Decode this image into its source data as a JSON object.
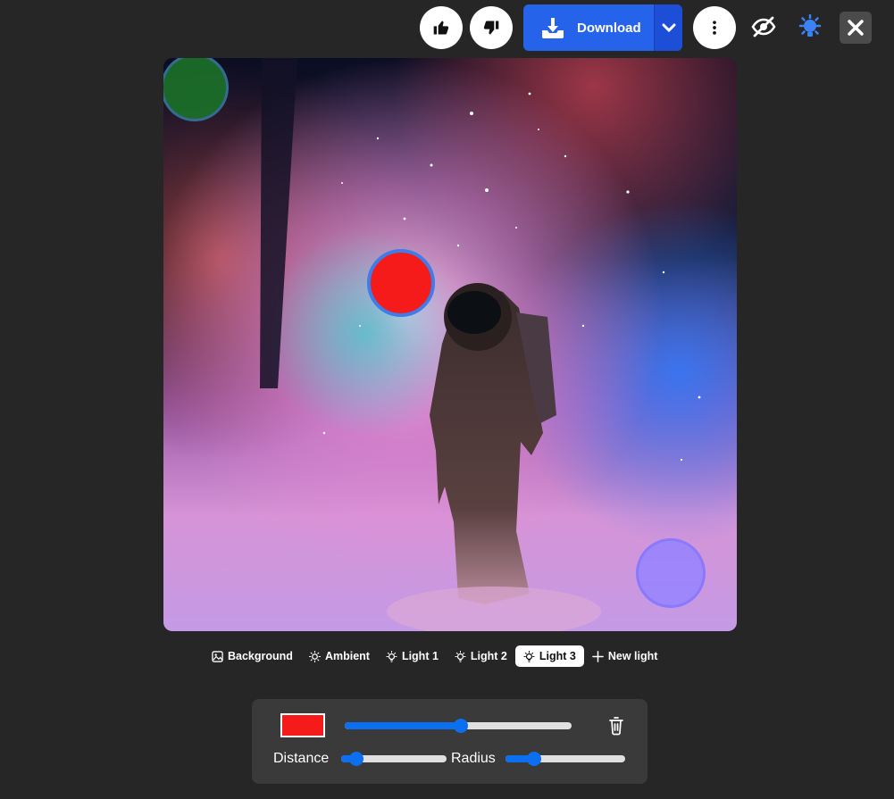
{
  "toolbar": {
    "download_label": "Download",
    "icons": [
      "thumbs-up-icon",
      "thumbs-down-icon",
      "download-icon",
      "chevron-down-icon",
      "more-vertical-icon",
      "eye-off-icon",
      "light-bulb-icon",
      "close-icon"
    ]
  },
  "colors": {
    "accent": "#2563eb",
    "background": "#262626",
    "panel": "#3a3a3a",
    "light3_color": "#f51b1b",
    "light1_color": "#1b6e28",
    "light2_color": "#9682ff"
  },
  "tabs": [
    {
      "label": "Background",
      "icon": "image-icon"
    },
    {
      "label": "Ambient",
      "icon": "sun-icon"
    },
    {
      "label": "Light 1",
      "icon": "bulb-icon"
    },
    {
      "label": "Light 2",
      "icon": "bulb-icon"
    },
    {
      "label": "Light 3",
      "icon": "bulb-icon",
      "active": true
    },
    {
      "label": "New light",
      "icon": "plus-icon"
    }
  ],
  "panel": {
    "color_value": "#f51b1b",
    "intensity": 0.51,
    "distance_label": "Distance",
    "distance": 0.14,
    "radius_label": "Radius",
    "radius": 0.24
  }
}
